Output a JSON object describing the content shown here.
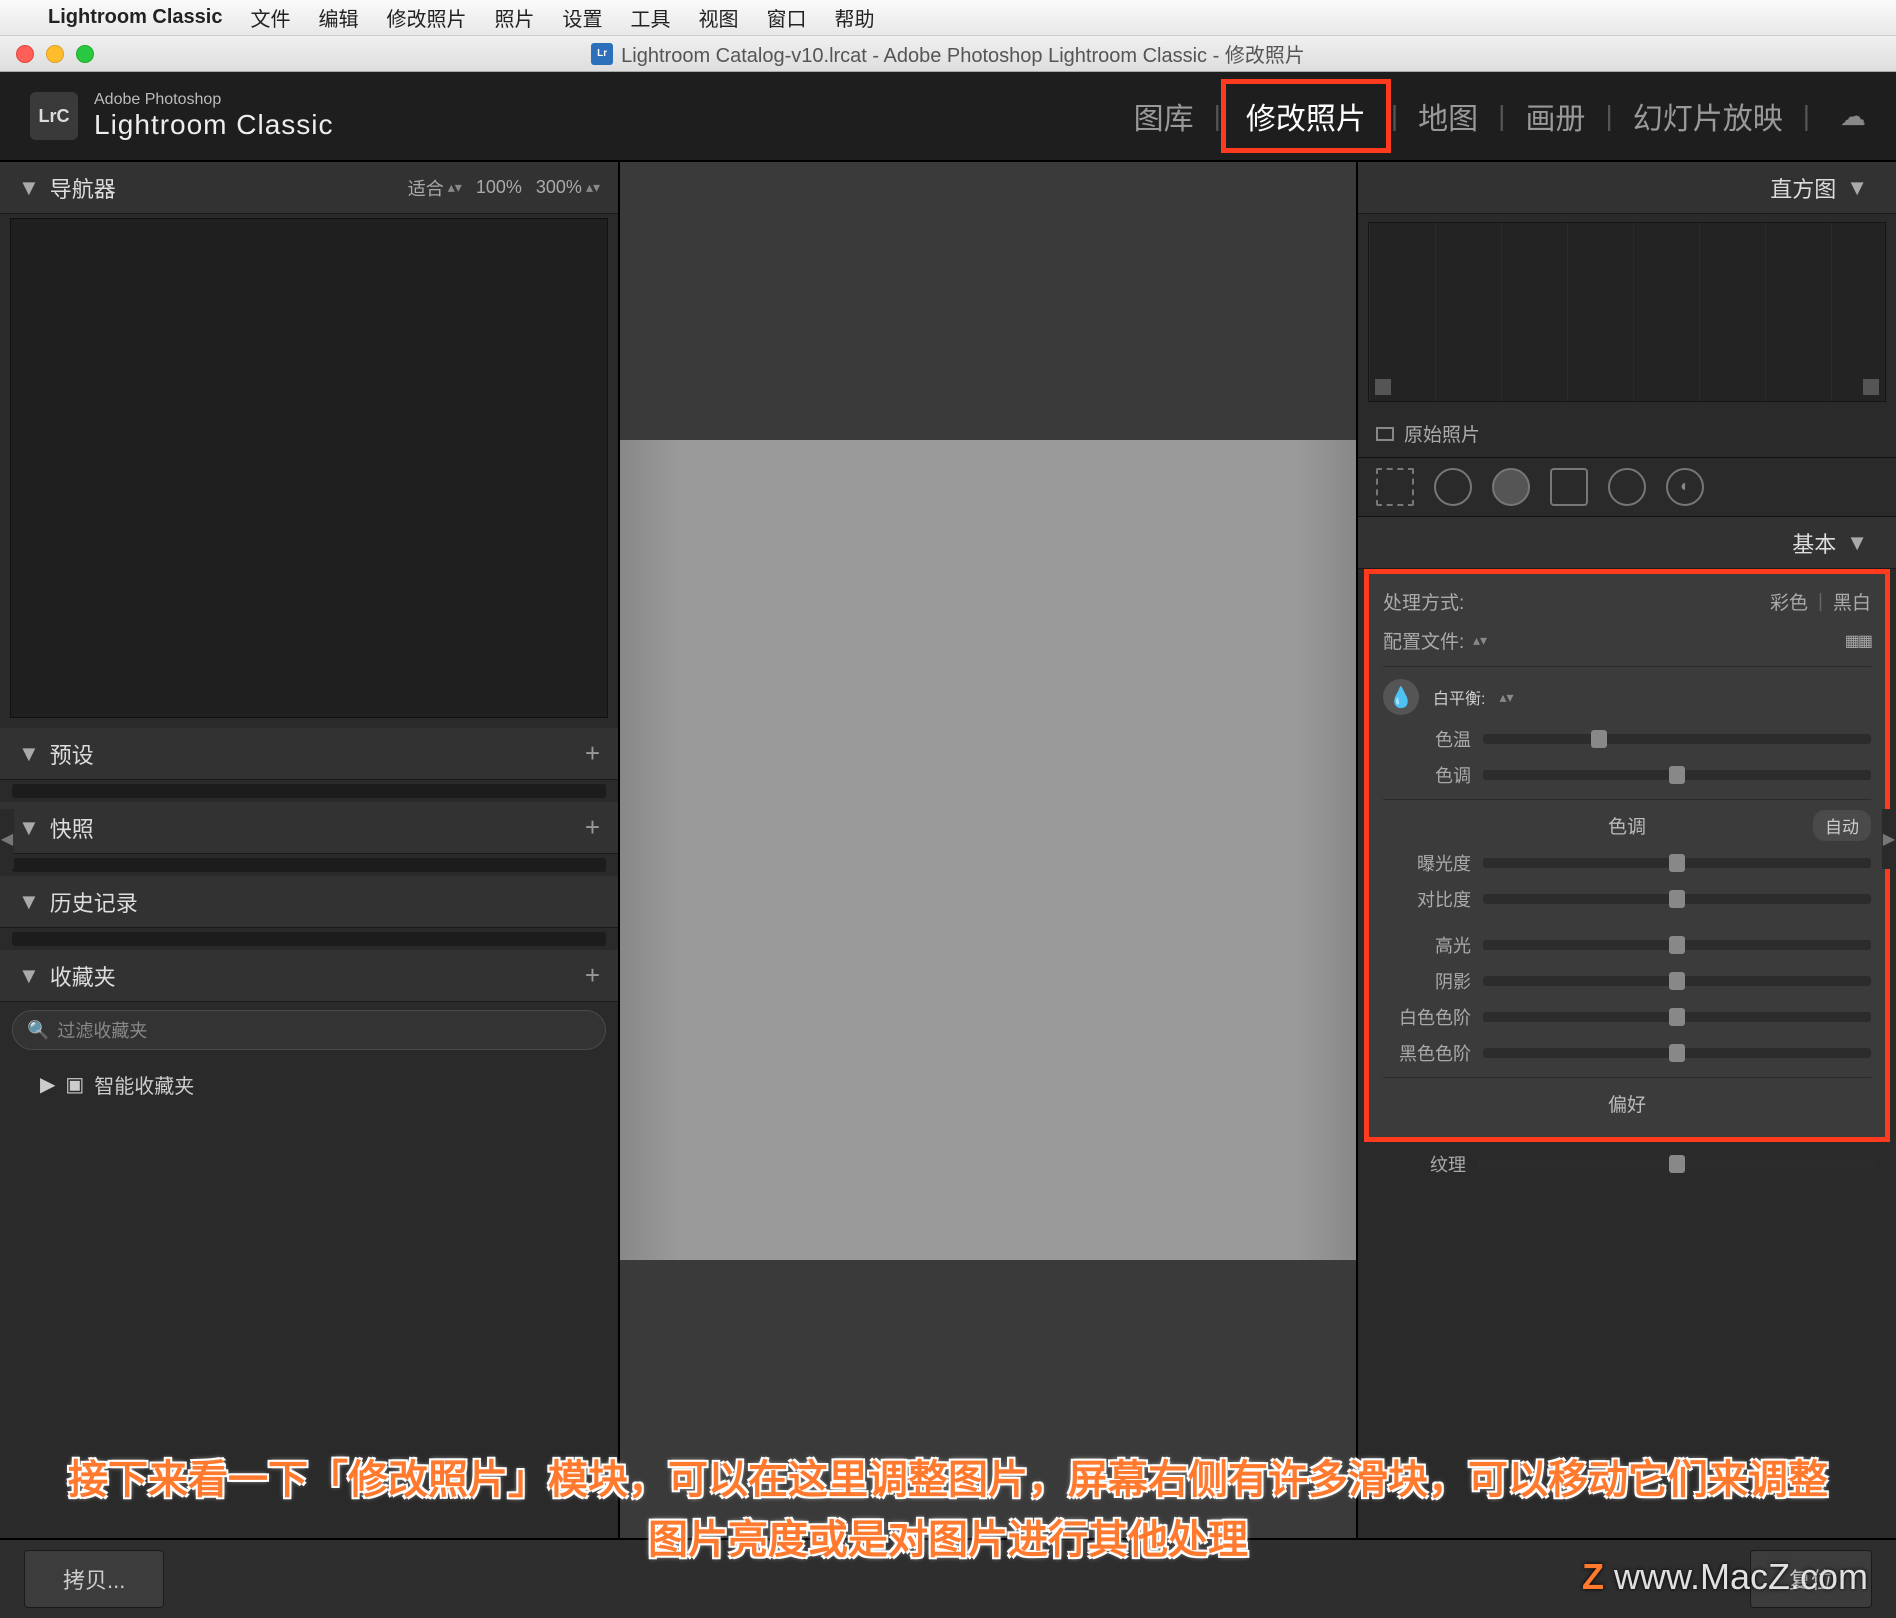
{
  "menubar": {
    "app": "Lightroom Classic",
    "items": [
      "文件",
      "编辑",
      "修改照片",
      "照片",
      "设置",
      "工具",
      "视图",
      "窗口",
      "帮助"
    ]
  },
  "window": {
    "title": "Lightroom Catalog-v10.lrcat - Adobe Photoshop Lightroom Classic - 修改照片"
  },
  "brand": {
    "line1": "Adobe Photoshop",
    "line2": "Lightroom Classic",
    "badge": "LrC"
  },
  "modules": [
    "图库",
    "修改照片",
    "地图",
    "画册",
    "幻灯片放映"
  ],
  "module_active_index": 1,
  "left": {
    "navigator": {
      "title": "导航器",
      "fit": "适合",
      "zoom1": "100%",
      "zoom2": "300%"
    },
    "presets": "预设",
    "snapshots": "快照",
    "history": "历史记录",
    "collections": "收藏夹",
    "filter_placeholder": "过滤收藏夹",
    "smart": "智能收藏夹"
  },
  "right": {
    "histogram": "直方图",
    "original": "原始照片",
    "basic_title": "基本",
    "treatment": {
      "label": "处理方式:",
      "color": "彩色",
      "bw": "黑白"
    },
    "profile": "配置文件:",
    "wb": "白平衡:",
    "sliders_wb": [
      "色温",
      "色调"
    ],
    "tone_title": "色调",
    "auto": "自动",
    "sliders_tone": [
      "曝光度",
      "对比度",
      "高光",
      "阴影",
      "白色色阶",
      "黑色色阶"
    ],
    "presence_title": "偏好",
    "texture": "纹理"
  },
  "toolbar": {
    "copy": "拷贝...",
    "reset": "复位"
  },
  "caption": "接下来看一下「修改照片」模块，可以在这里调整图片，屏幕右侧有许多滑块，可以移动它们来调整图片亮度或是对图片进行其他处理",
  "watermark": "www.MacZ.com"
}
